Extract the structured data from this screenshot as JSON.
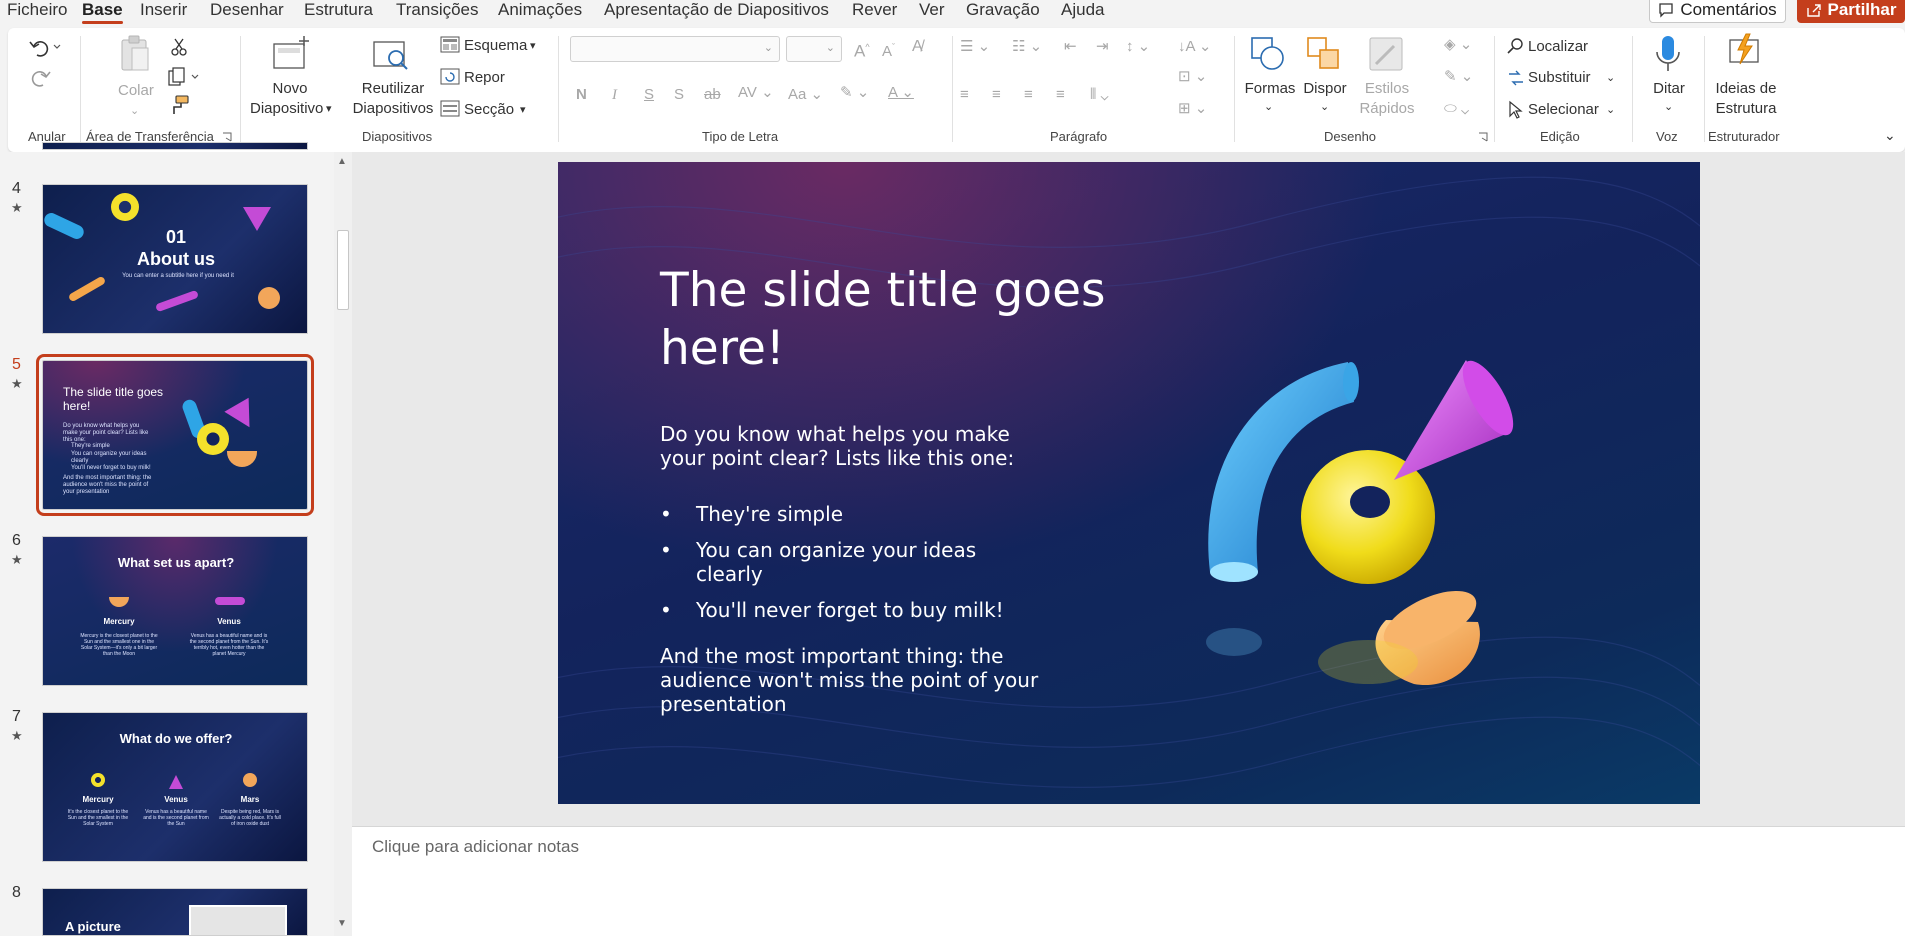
{
  "menu": {
    "items": [
      "Ficheiro",
      "Base",
      "Inserir",
      "Desenhar",
      "Estrutura",
      "Transições",
      "Animações",
      "Apresentação de Diapositivos",
      "Rever",
      "Ver",
      "Gravação",
      "Ajuda"
    ],
    "active": "Base",
    "comments_label": "Comentários",
    "share_label": "Partilhar"
  },
  "ribbon": {
    "undo_group": "Anular",
    "clipboard": {
      "paste": "Colar",
      "group": "Área de Transferência"
    },
    "slides": {
      "new_slide": "Novo",
      "new_slide2": "Diapositivo",
      "reuse": "Reutilizar",
      "reuse2": "Diapositivos",
      "layout": "Esquema",
      "reset": "Repor",
      "section": "Secção",
      "group": "Diapositivos"
    },
    "font": {
      "group": "Tipo de Letra",
      "font_name": "",
      "font_size": ""
    },
    "paragraph": {
      "group": "Parágrafo"
    },
    "drawing": {
      "shapes": "Formas",
      "arrange": "Dispor",
      "quick_styles": "Estilos",
      "quick_styles2": "Rápidos",
      "group": "Desenho"
    },
    "editing": {
      "find": "Localizar",
      "replace": "Substituir",
      "select": "Selecionar",
      "group": "Edição"
    },
    "voice": {
      "dictate": "Ditar",
      "group": "Voz"
    },
    "designer": {
      "ideas": "Ideias de",
      "ideas2": "Estrutura",
      "group": "Estruturador"
    }
  },
  "thumbnails": [
    {
      "number": "4",
      "title": "01",
      "subtitle_title": "About us",
      "text": "You can enter a subtitle here if you need it"
    },
    {
      "number": "5",
      "title": "The slide title goes here!",
      "text": "Do you know what helps you make your point clear? Lists like this one:",
      "items": [
        "They're simple",
        "You can organize your ideas clearly",
        "You'll never forget to buy milk!"
      ],
      "footer": "And the most important thing: the audience won't miss the point of your presentation"
    },
    {
      "number": "6",
      "title": "What set us apart?",
      "col1": "Mercury",
      "col2": "Venus",
      "col1_text": "Mercury is the closest planet to the Sun and the smallest one in the Solar System—it's only a bit larger than the Moon",
      "col2_text": "Venus has a beautiful name and is the second planet from the Sun. It's terribly hot, even hotter than the planet Mercury"
    },
    {
      "number": "7",
      "title": "What do we offer?",
      "col1": "Mercury",
      "col2": "Venus",
      "col3": "Mars",
      "col1_text": "It's the closest planet to the Sun and the smallest in the Solar System",
      "col2_text": "Venus has a beautiful name and is the second planet from the Sun",
      "col3_text": "Despite being red, Mars is actually a cold place. It's full of iron oxide dust"
    },
    {
      "number": "8",
      "title": "A picture"
    }
  ],
  "slide": {
    "title": "The slide title goes here!",
    "intro": "Do you know what helps you make your point clear? Lists like this one:",
    "bullets": [
      "They're simple",
      "You can organize your ideas clearly",
      "You'll never forget to buy milk!"
    ],
    "outro": "And the most important thing: the audience won't miss the point of your presentation"
  },
  "notes": {
    "placeholder": "Clique para adicionar notas"
  },
  "colors": {
    "accent": "#c43e1c",
    "slide_bg": "#13235c"
  }
}
